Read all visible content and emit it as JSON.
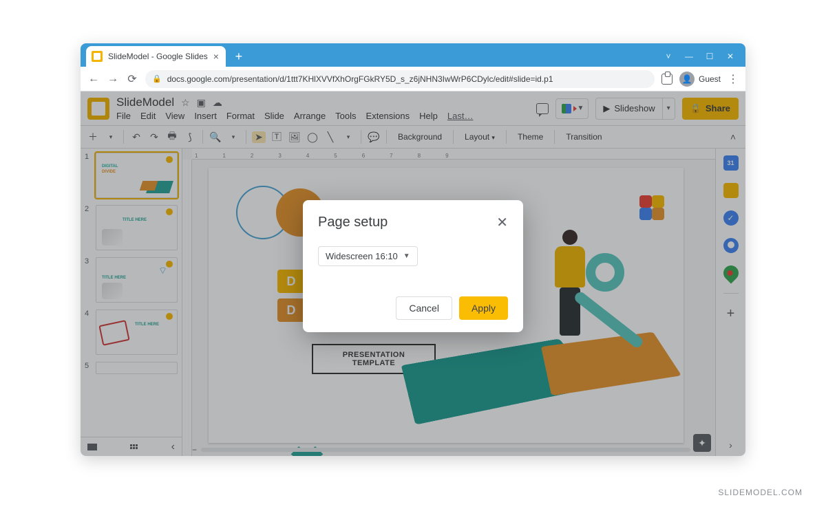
{
  "browser": {
    "tab_title": "SlideModel - Google Slides",
    "url": "docs.google.com/presentation/d/1ttt7KHlXVVfXhOrgFGkRY5D_s_z6jNHN3IwWrP6CDylc/edit#slide=id.p1",
    "guest_label": "Guest"
  },
  "doc": {
    "title": "SlideModel",
    "menus": [
      "File",
      "Edit",
      "View",
      "Insert",
      "Format",
      "Slide",
      "Arrange",
      "Tools",
      "Extensions",
      "Help",
      "Last…"
    ],
    "slideshow_label": "Slideshow",
    "share_label": "Share"
  },
  "toolbar": {
    "background": "Background",
    "layout": "Layout",
    "theme": "Theme",
    "transition": "Transition"
  },
  "ruler_marks": [
    "1",
    "1",
    "2",
    "3",
    "4",
    "5",
    "6",
    "7",
    "8",
    "9"
  ],
  "slide": {
    "d1": "D",
    "d2": "D",
    "pres_line1": "PRESENTATION",
    "pres_line2": "TEMPLATE"
  },
  "filmstrip": {
    "items": [
      {
        "num": "1",
        "t1": "DIGITAL",
        "t2": "DIVIDE"
      },
      {
        "num": "2",
        "title": "TITLE HERE"
      },
      {
        "num": "3",
        "title": "TITLE HERE"
      },
      {
        "num": "4",
        "title": "TITLE HERE"
      },
      {
        "num": "5",
        "title": ""
      }
    ]
  },
  "dialog": {
    "title": "Page setup",
    "selected": "Widescreen 16:10",
    "cancel": "Cancel",
    "apply": "Apply"
  },
  "watermark": "SLIDEMODEL.COM"
}
